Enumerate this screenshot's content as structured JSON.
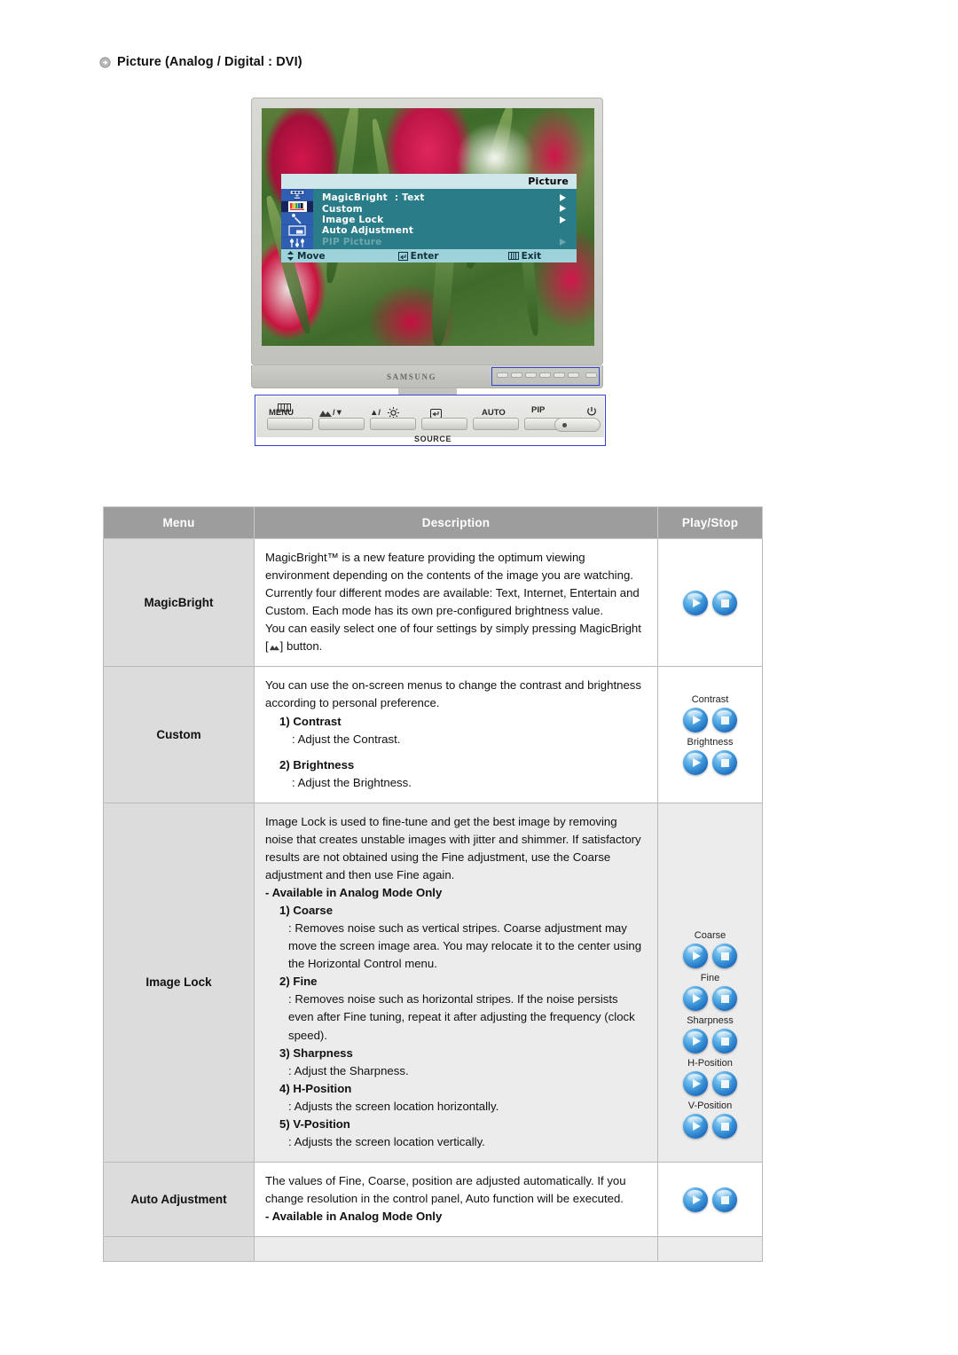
{
  "page": {
    "heading": "Picture (Analog / Digital : DVI)",
    "heading_icon": "circle-arrow-icon"
  },
  "monitor": {
    "brand": "SAMSUNG",
    "osd": {
      "title": "Picture",
      "sidebar_icons": [
        "input-source-icon",
        "color-bars-icon",
        "magic-wand-icon",
        "pip-window-icon",
        "setup-sliders-icon"
      ],
      "selected_sidebar_index": 1,
      "items": [
        {
          "label": "MagicBright",
          "value": ": Text",
          "arrow": true,
          "disabled": false
        },
        {
          "label": "Custom",
          "value": "",
          "arrow": true,
          "disabled": false
        },
        {
          "label": "Image Lock",
          "value": "",
          "arrow": true,
          "disabled": false
        },
        {
          "label": "Auto Adjustment",
          "value": "",
          "arrow": false,
          "disabled": false
        },
        {
          "label": "PIP Picture",
          "value": "",
          "arrow": true,
          "disabled": true
        }
      ],
      "footer": {
        "move": "Move",
        "move_icon": "up-down-arrows-icon",
        "enter": "Enter",
        "enter_icon": "enter-key-icon",
        "exit": "Exit",
        "exit_icon": "menu-bars-icon"
      }
    },
    "control_panel": {
      "buttons": [
        {
          "label": "MENU",
          "icon": "menu-bars-icon"
        },
        {
          "label": "/▼",
          "icon": "magicbright-icon"
        },
        {
          "label": "▲/",
          "icon": "brightness-sun-icon"
        },
        {
          "label": "",
          "icon": "source-enter-icon"
        },
        {
          "label": "AUTO",
          "icon": ""
        },
        {
          "label": "PIP",
          "icon": ""
        }
      ],
      "source_label": "SOURCE",
      "power_icon": "power-icon"
    }
  },
  "table": {
    "headers": [
      "Menu",
      "Description",
      "Play/Stop"
    ],
    "rows": [
      {
        "menu": "MagicBright",
        "desc_paragraphs": [
          "MagicBright™ is a new feature providing the optimum viewing environment depending on the contents of the image you are watching. Currently four different modes are available: Text, Internet, Entertain and Custom. Each mode has its own pre-configured brightness value.",
          "You can easily select one of four settings by simply pressing MagicBright [ ] button."
        ],
        "controls": [
          {
            "label": "",
            "buttons": [
              "play-button",
              "stop-button"
            ]
          }
        ]
      },
      {
        "menu": "Custom",
        "desc_intro": "You can use the on-screen menus to change the contrast and brightness according to personal preference.",
        "items": [
          {
            "title": "1) Contrast",
            "body": ": Adjust the Contrast."
          },
          {
            "title": "2) Brightness",
            "body": ": Adjust the Brightness."
          }
        ],
        "controls": [
          {
            "label": "Contrast",
            "buttons": [
              "play-button",
              "stop-button"
            ]
          },
          {
            "label": "Brightness",
            "buttons": [
              "play-button",
              "stop-button"
            ]
          }
        ]
      },
      {
        "menu": "Image Lock",
        "desc_intro": "Image Lock is used to fine-tune and get the best image by removing noise that creates unstable images with jitter and shimmer. If satisfactory results are not obtained using the Fine adjustment, use the Coarse adjustment and then use Fine again.",
        "note": "- Available in Analog Mode Only",
        "items": [
          {
            "title": "1) Coarse",
            "body": ": Removes noise such as vertical stripes. Coarse adjustment may move the screen image area. You may relocate it to the center using the Horizontal Control menu."
          },
          {
            "title": "2) Fine",
            "body": ": Removes noise such as horizontal stripes. If the noise persists even after Fine tuning, repeat it after adjusting the frequency (clock speed)."
          },
          {
            "title": "3) Sharpness",
            "body": ": Adjust the Sharpness."
          },
          {
            "title": "4) H-Position",
            "body": ": Adjusts the screen location horizontally."
          },
          {
            "title": "5) V-Position",
            "body": ": Adjusts the screen location vertically."
          }
        ],
        "controls": [
          {
            "label": "Coarse",
            "buttons": [
              "play-button",
              "stop-button"
            ]
          },
          {
            "label": "Fine",
            "buttons": [
              "play-button",
              "stop-button"
            ]
          },
          {
            "label": "Sharpness",
            "buttons": [
              "play-button",
              "stop-button"
            ]
          },
          {
            "label": "H-Position",
            "buttons": [
              "play-button",
              "stop-button"
            ]
          },
          {
            "label": "V-Position",
            "buttons": [
              "play-button",
              "stop-button"
            ]
          }
        ]
      },
      {
        "menu": "Auto Adjustment",
        "desc_intro": "The values of Fine, Coarse, position are adjusted automatically. If you change resolution in the control panel, Auto function will be executed.",
        "note": "- Available in Analog Mode Only",
        "controls": [
          {
            "label": "",
            "buttons": [
              "play-button",
              "stop-button"
            ]
          }
        ]
      }
    ]
  },
  "colors": {
    "header_bg": "#9d9d9d",
    "menu_cell_bg": "#dcdcdc",
    "desc_cell_bg": "#ececec",
    "osd_teal": "#2a7d88",
    "osd_blue": "#2f5fb2",
    "callout_blue": "#3344cc",
    "button_blue": "#1f6fc0"
  }
}
